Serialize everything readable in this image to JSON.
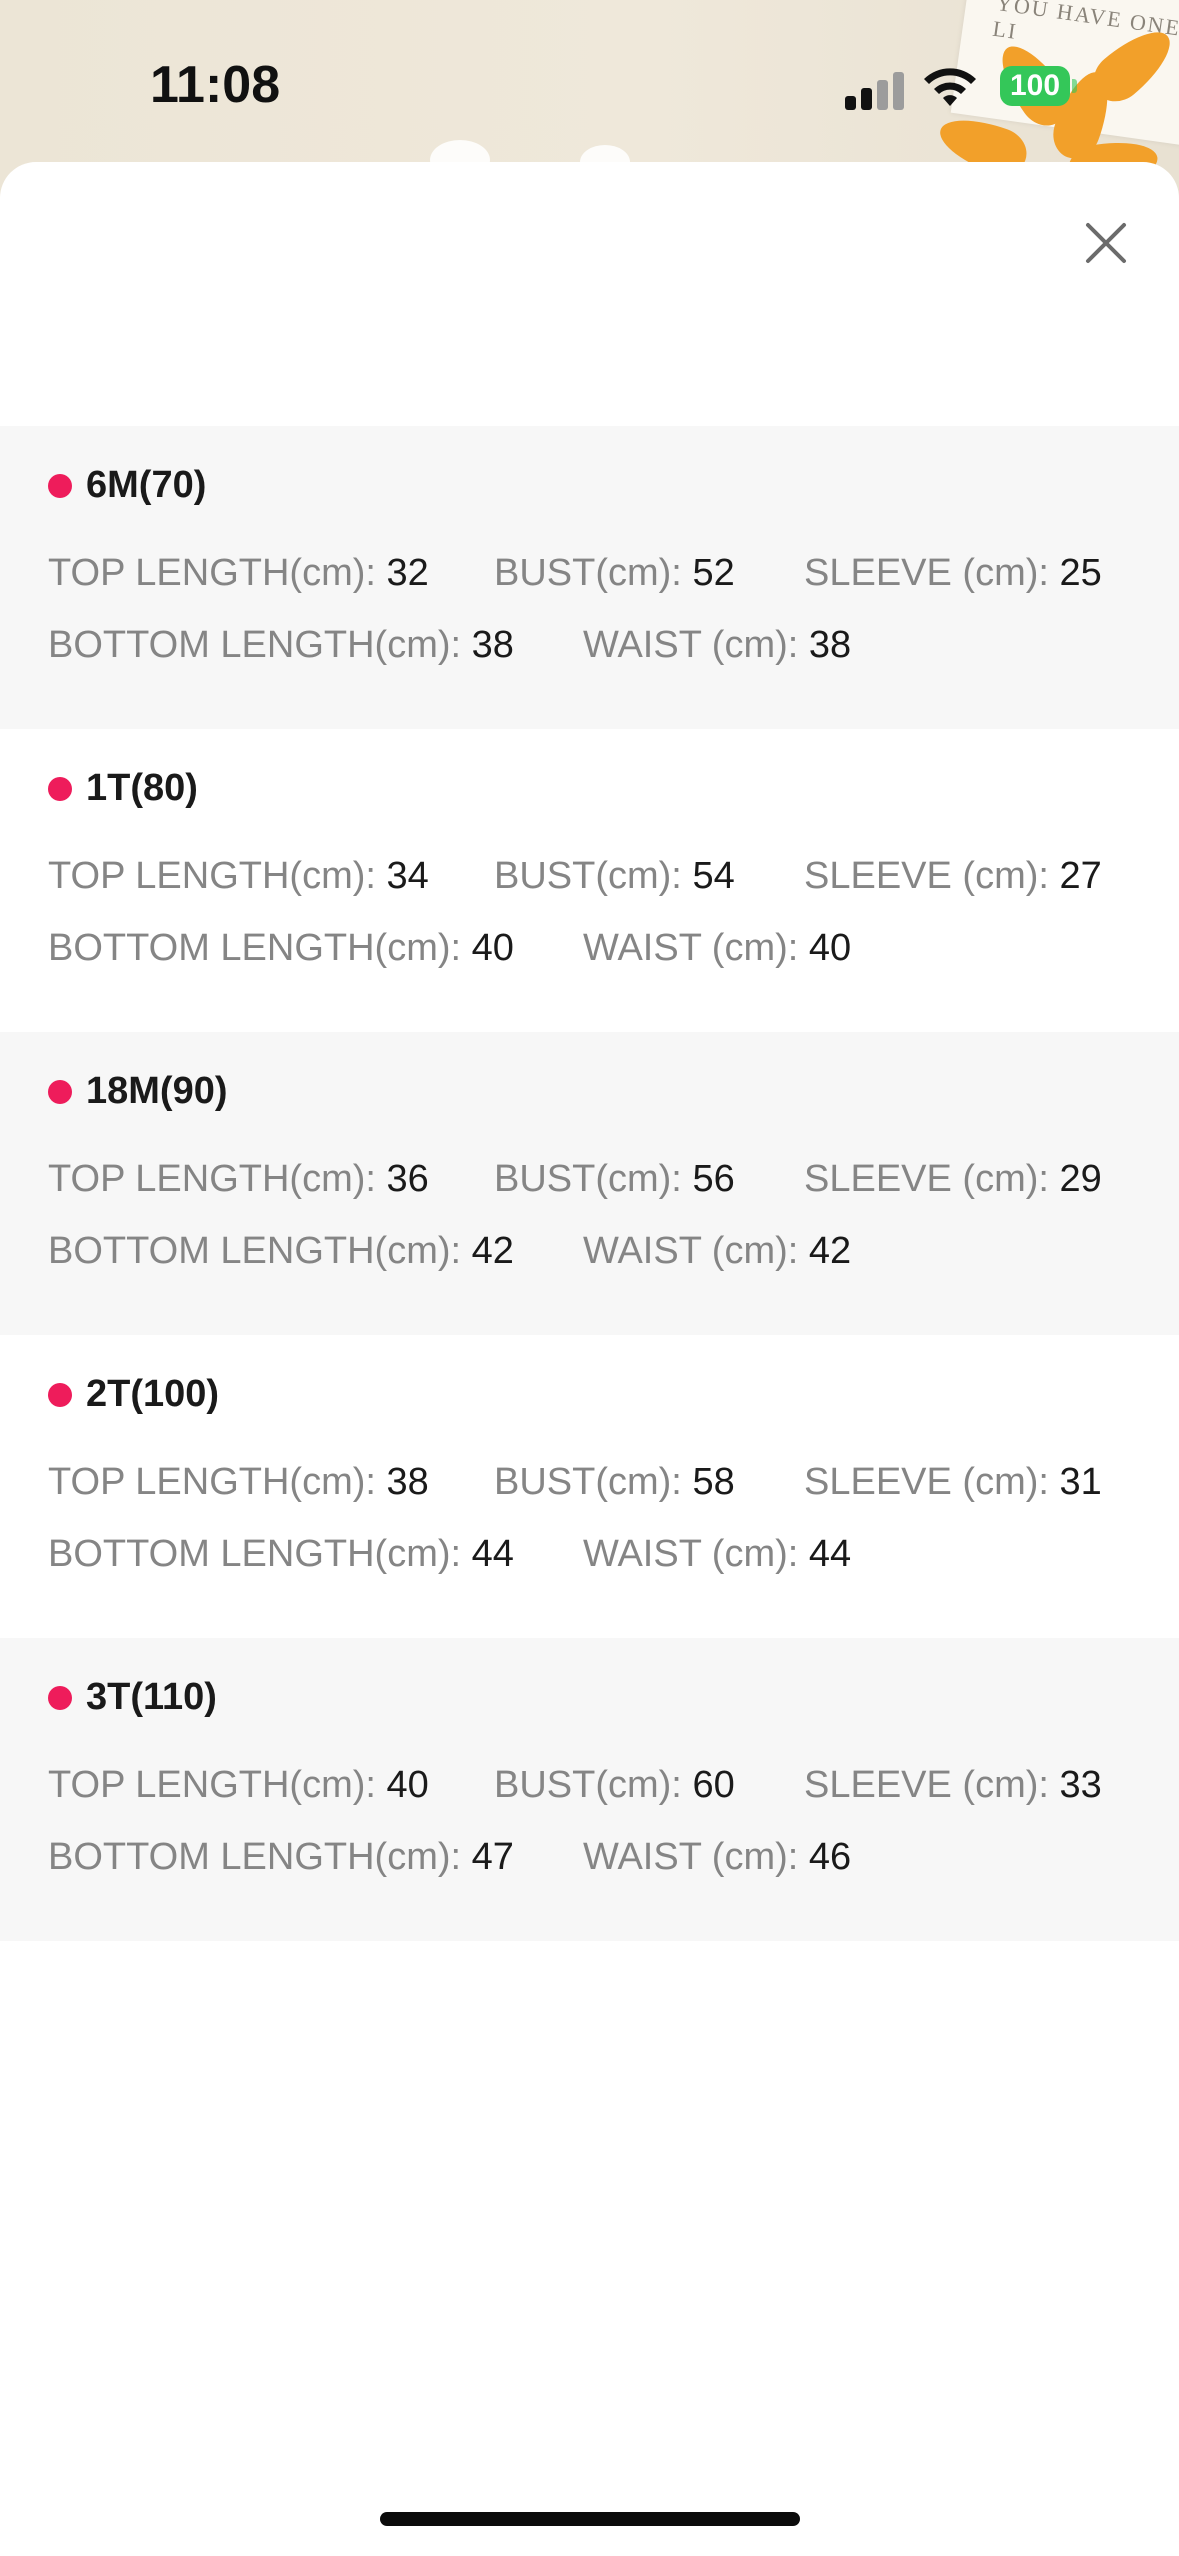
{
  "status_bar": {
    "time": "11:08",
    "battery": "100"
  },
  "background": {
    "card_text": "YOU HAVE ONE LI"
  },
  "colors": {
    "accent_dot": "#ee1c5b",
    "battery": "#34c759"
  },
  "icons": {
    "close": "close-icon",
    "signal": "cellular-signal-icon",
    "wifi": "wifi-icon",
    "battery": "battery-icon"
  },
  "labels": {
    "top_length": "TOP LENGTH(cm): ",
    "bust": "BUST(cm): ",
    "sleeve": "SLEEVE (cm): ",
    "bottom_length": "BOTTOM LENGTH(cm): ",
    "waist": "WAIST (cm): "
  },
  "sizes": [
    {
      "name": "6M(70)",
      "top_length": "32",
      "bust": "52",
      "sleeve": "25",
      "bottom_length": "38",
      "waist": "38"
    },
    {
      "name": "1T(80)",
      "top_length": "34",
      "bust": "54",
      "sleeve": "27",
      "bottom_length": "40",
      "waist": "40"
    },
    {
      "name": "18M(90)",
      "top_length": "36",
      "bust": "56",
      "sleeve": "29",
      "bottom_length": "42",
      "waist": "42"
    },
    {
      "name": "2T(100)",
      "top_length": "38",
      "bust": "58",
      "sleeve": "31",
      "bottom_length": "44",
      "waist": "44"
    },
    {
      "name": "3T(110)",
      "top_length": "40",
      "bust": "60",
      "sleeve": "33",
      "bottom_length": "47",
      "waist": "46"
    }
  ]
}
